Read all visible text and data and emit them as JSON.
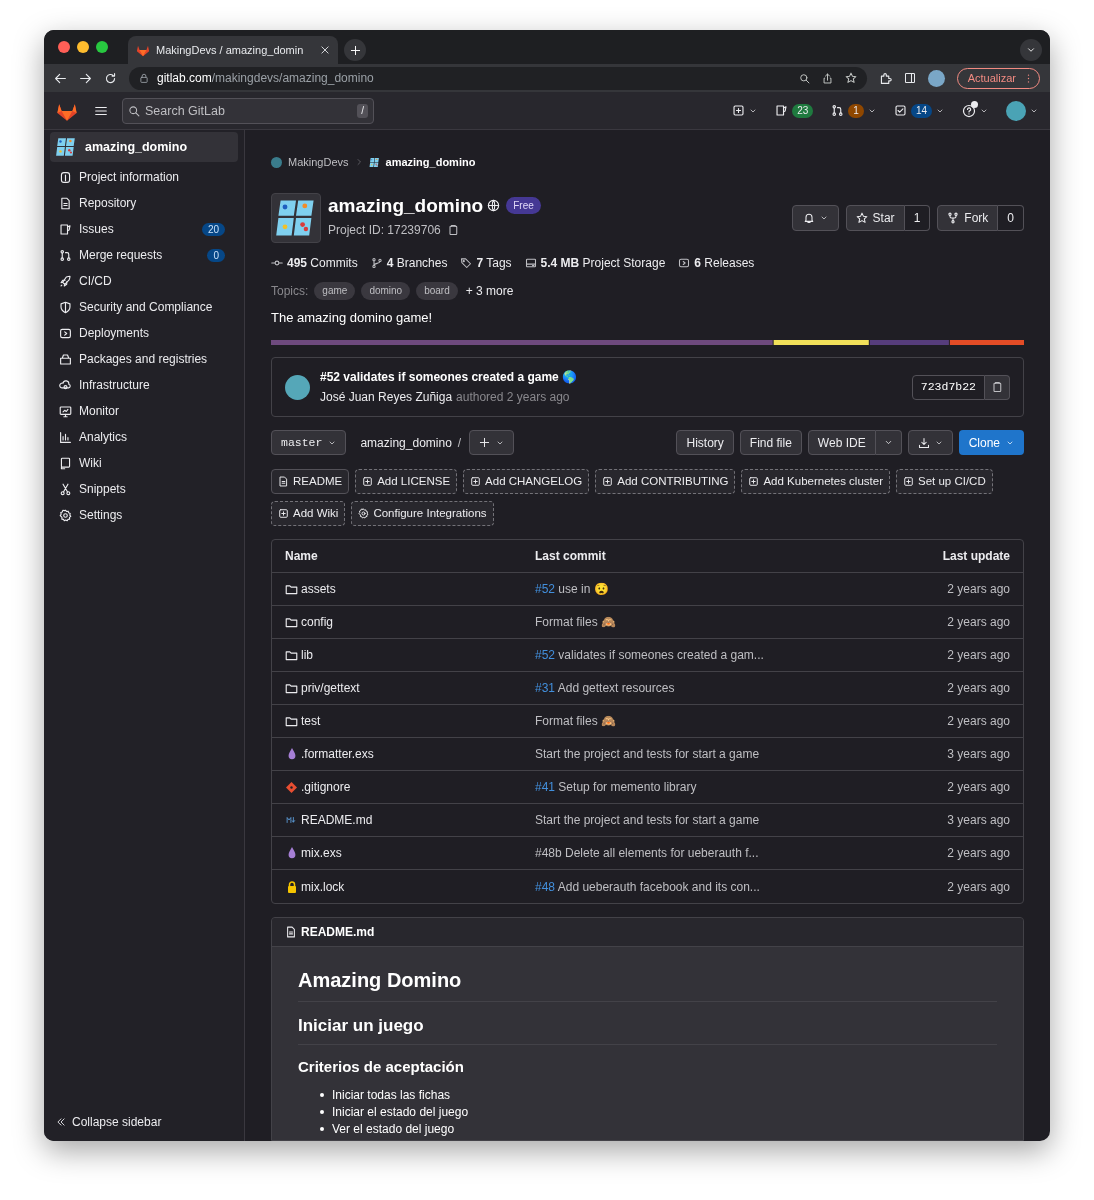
{
  "browser": {
    "tab_title": "MakingDevs / amazing_domin",
    "url_host": "gitlab.com",
    "url_path": "/makingdevs/amazing_domino",
    "update_button": "Actualizar"
  },
  "topbar": {
    "search": {
      "placeholder": "Search GitLab"
    },
    "shortcut": "/",
    "counters": [
      {
        "kind": "issues",
        "count": "23",
        "color": "#1f7a3f"
      },
      {
        "kind": "merge",
        "count": "1",
        "color": "#8f4700"
      },
      {
        "kind": "todo",
        "count": "14",
        "color": "#064787"
      }
    ]
  },
  "sidebar": {
    "project": {
      "label": "amazing_domino",
      "selected": true
    },
    "items": [
      {
        "label": "Project information",
        "selected": false
      },
      {
        "label": "Repository",
        "selected": false
      },
      {
        "label": "Issues",
        "badge": "20",
        "selected": false
      },
      {
        "label": "Merge requests",
        "badge": "0",
        "selected": false
      },
      {
        "label": "CI/CD",
        "selected": false
      },
      {
        "label": "Security and Compliance",
        "selected": false
      },
      {
        "label": "Deployments",
        "selected": false
      },
      {
        "label": "Packages and registries",
        "selected": false
      },
      {
        "label": "Infrastructure",
        "selected": false
      },
      {
        "label": "Monitor",
        "selected": false
      },
      {
        "label": "Analytics",
        "selected": false
      },
      {
        "label": "Wiki",
        "selected": false
      },
      {
        "label": "Snippets",
        "selected": false
      },
      {
        "label": "Settings",
        "selected": false
      }
    ],
    "collapse": "Collapse sidebar"
  },
  "breadcrumbs": [
    "MakingDevs",
    "amazing_domino"
  ],
  "project": {
    "name": "amazing_domino",
    "plan": "Free",
    "id_label": "Project ID: 17239706"
  },
  "actions": {
    "star": "Star",
    "star_count": "1",
    "fork": "Fork",
    "fork_count": "0"
  },
  "stats": [
    {
      "value": "495",
      "label": "Commits"
    },
    {
      "value": "4",
      "label": "Branches"
    },
    {
      "value": "7",
      "label": "Tags"
    },
    {
      "value": "5.4 MB",
      "label": "Project Storage"
    },
    {
      "value": "6",
      "label": "Releases"
    }
  ],
  "topics": {
    "label": "Topics:",
    "tags": [
      "game",
      "domino",
      "board"
    ],
    "more": "+ 3 more"
  },
  "description": "The amazing domino game!",
  "last_commit": {
    "title": "#52 validates if someones created a game 🌎",
    "author": "José Juan Reyes Zuñiga",
    "meta": "authored 2 years ago",
    "sha": "723d7b22"
  },
  "toolbar": {
    "branch": "master",
    "path": "amazing_domino",
    "separator": "/",
    "buttons": [
      "History",
      "Find file",
      "Web IDE"
    ],
    "clone": "Clone"
  },
  "shortcuts": [
    {
      "label": "README",
      "kind": "file"
    },
    {
      "label": "Add LICENSE",
      "kind": "add"
    },
    {
      "label": "Add CHANGELOG",
      "kind": "add"
    },
    {
      "label": "Add CONTRIBUTING",
      "kind": "add"
    },
    {
      "label": "Add Kubernetes cluster",
      "kind": "add"
    },
    {
      "label": "Set up CI/CD",
      "kind": "add"
    },
    {
      "label": "Add Wiki",
      "kind": "add"
    },
    {
      "label": "Configure Integrations",
      "kind": "settings"
    }
  ],
  "table": {
    "columns": [
      "Name",
      "Last commit",
      "Last update"
    ],
    "rows": [
      {
        "kind": "folder",
        "name": "assets",
        "ref": "#52",
        "message": "use in 😧",
        "updated": "2 years ago"
      },
      {
        "kind": "folder",
        "name": "config",
        "message": "Format files 🙈",
        "updated": "2 years ago"
      },
      {
        "kind": "folder",
        "name": "lib",
        "ref": "#52",
        "message": "validates if someones created a gam...",
        "updated": "2 years ago"
      },
      {
        "kind": "folder",
        "name": "priv/gettext",
        "ref": "#31",
        "message": "Add gettext resources",
        "updated": "2 years ago"
      },
      {
        "kind": "folder",
        "name": "test",
        "message": "Format files 🙈",
        "updated": "2 years ago"
      },
      {
        "kind": "elixir",
        "name": ".formatter.exs",
        "message": "Start the project and tests for start a game",
        "updated": "3 years ago"
      },
      {
        "kind": "git",
        "name": ".gitignore",
        "ref": "#41",
        "message": "Setup for memento library",
        "updated": "2 years ago"
      },
      {
        "kind": "markdown",
        "name": "README.md",
        "message": "Start the project and tests for start a game",
        "updated": "3 years ago"
      },
      {
        "kind": "elixir",
        "name": "mix.exs",
        "message": "#48b Delete all elements for ueberauth f...",
        "updated": "2 years ago"
      },
      {
        "kind": "lock",
        "name": "mix.lock",
        "ref": "#48",
        "message": "Add ueberauth facebook and its con...",
        "updated": "2 years ago"
      }
    ]
  },
  "readme": {
    "filename": "README.md",
    "h1": "Amazing Domino",
    "h2": "Iniciar un juego",
    "h3": "Criterios de aceptación",
    "items": [
      "Iniciar todas las fichas",
      "Iniciar el estado del juego",
      "Ver el estado del juego"
    ]
  }
}
